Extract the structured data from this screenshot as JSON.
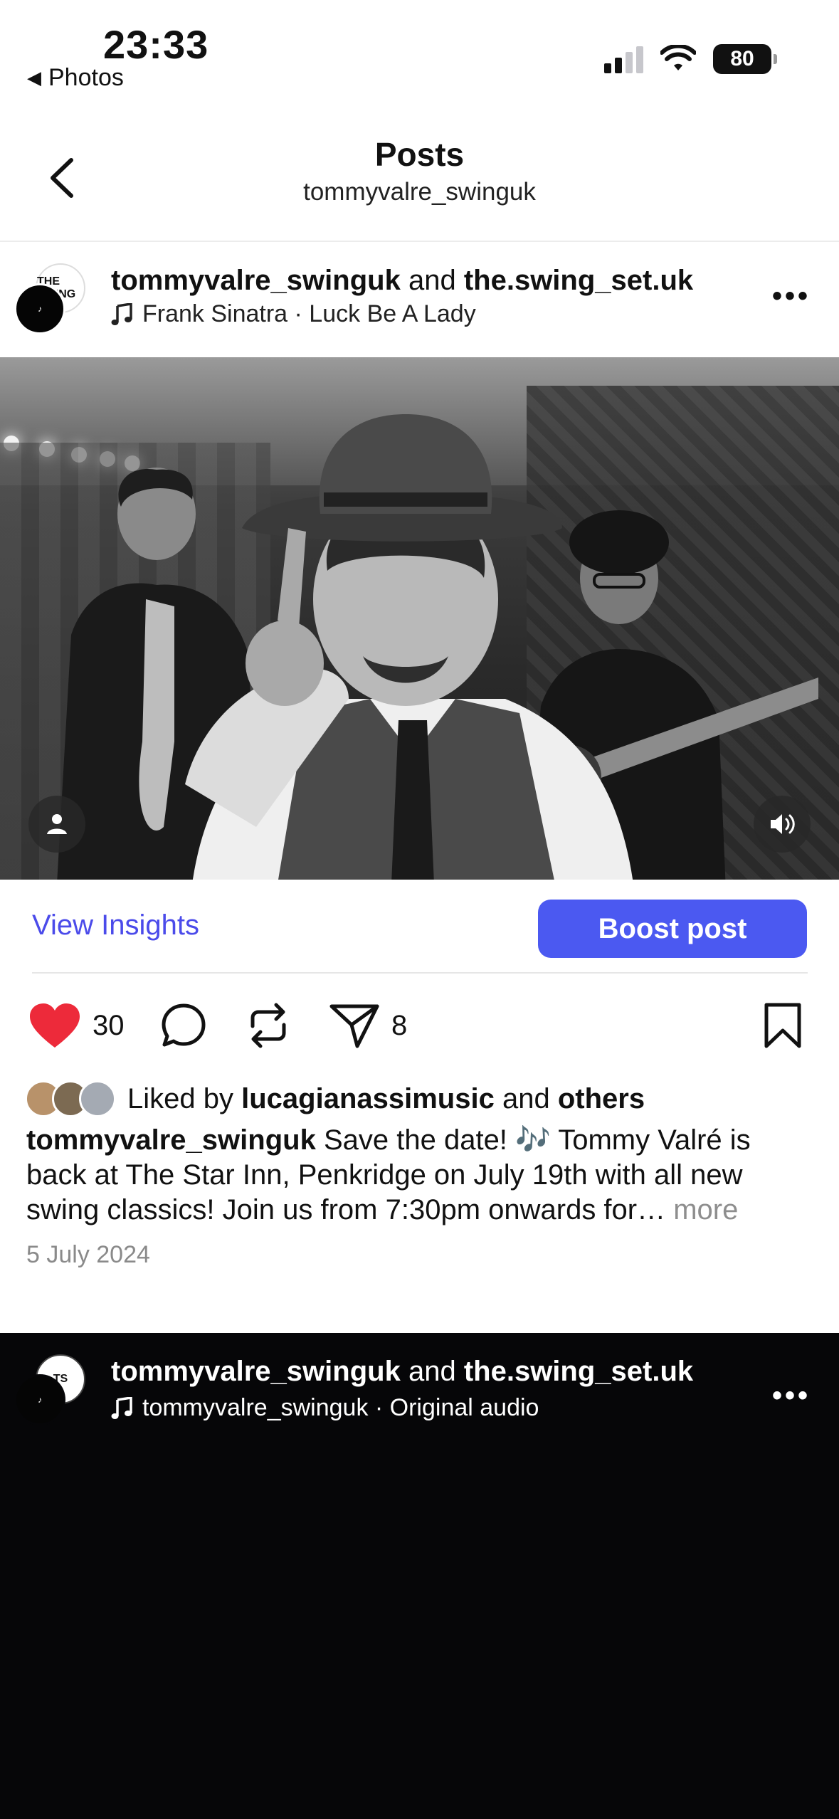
{
  "status_bar": {
    "time": "23:33",
    "back_app": "Photos",
    "battery": "80"
  },
  "header": {
    "title": "Posts",
    "subtitle": "tommyvalre_swinguk"
  },
  "post1": {
    "author": "tommyvalre_swinguk",
    "joiner": "and",
    "collaborator": "the.swing_set.uk",
    "audio": "Frank Sinatra · Luck Be A Lady",
    "avatar_text": "THE SWING",
    "view_insights": "View Insights",
    "boost_label": "Boost post",
    "likes": "30",
    "shares": "8",
    "liked_by_prefix": "Liked by",
    "liked_by_user": "lucagianassimusic",
    "liked_by_joiner": "and",
    "liked_by_others": "others",
    "caption_user": "tommyvalre_swinguk",
    "caption_text": "Save the date! 🎶 Tommy Valré is back at The Star Inn, Penkridge on July 19th with all new swing classics! Join us from 7:30pm onwards for…",
    "caption_more": "more",
    "date": "5 July 2024"
  },
  "post2": {
    "author": "tommyvalre_swinguk",
    "joiner": "and",
    "collaborator": "the.swing_set.uk",
    "audio": "tommyvalre_swinguk · Original audio"
  },
  "colors": {
    "accent_blue": "#4b59f1",
    "link_blue": "#4b4bea",
    "heart_red": "#ed2a3a"
  }
}
